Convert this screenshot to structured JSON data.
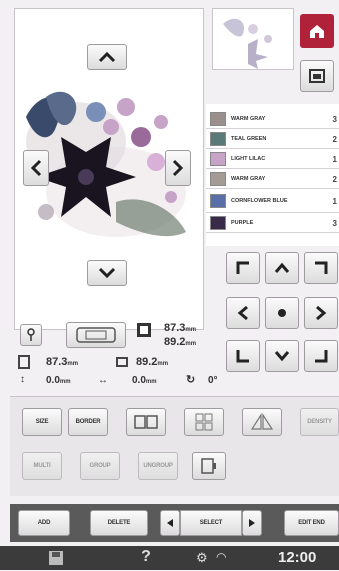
{
  "nav": {
    "up_arrow": "⌃",
    "down_arrow": "⌄",
    "left_arrow": "<",
    "right_arrow": ">"
  },
  "colors": [
    {
      "name": "WARM GRAY",
      "num": "3",
      "color": "#9a8f8c"
    },
    {
      "name": "TEAL GREEN",
      "num": "2",
      "color": "#5a7a78"
    },
    {
      "name": "LIGHT LILAC",
      "num": "1",
      "color": "#c7a3c7"
    },
    {
      "name": "WARM GRAY",
      "num": "2",
      "color": "#a49a96"
    },
    {
      "name": "CORNFLOWER BLUE",
      "num": "1",
      "color": "#5a6fa8"
    },
    {
      "name": "PURPLE",
      "num": "3",
      "color": "#3a2a4a"
    }
  ],
  "size": {
    "width": "87.3",
    "height": "89.2",
    "unit": "mm"
  },
  "position": {
    "x_label": "87.3",
    "y_label": "89.2",
    "unit": "mm"
  },
  "offset": {
    "x": "0.0",
    "y": "0.0",
    "unit": "mm",
    "angle": "0°"
  },
  "tools": {
    "size_label": "SIZE",
    "border_label": "BORDER",
    "mirror_label": "MIRROR",
    "density_label": "DENSITY",
    "multi_label": "MULTI",
    "group_label": "GROUP",
    "ungroup_label": "UNGROUP"
  },
  "bottom": {
    "add_label": "ADD",
    "delete_label": "DELETE",
    "select_label": "SELECT",
    "edit_end_label": "EDIT END",
    "time": "12:00",
    "help_glyph": "?"
  },
  "brand": {
    "accent": "#b0223a",
    "bar": "#3b3b3b"
  }
}
